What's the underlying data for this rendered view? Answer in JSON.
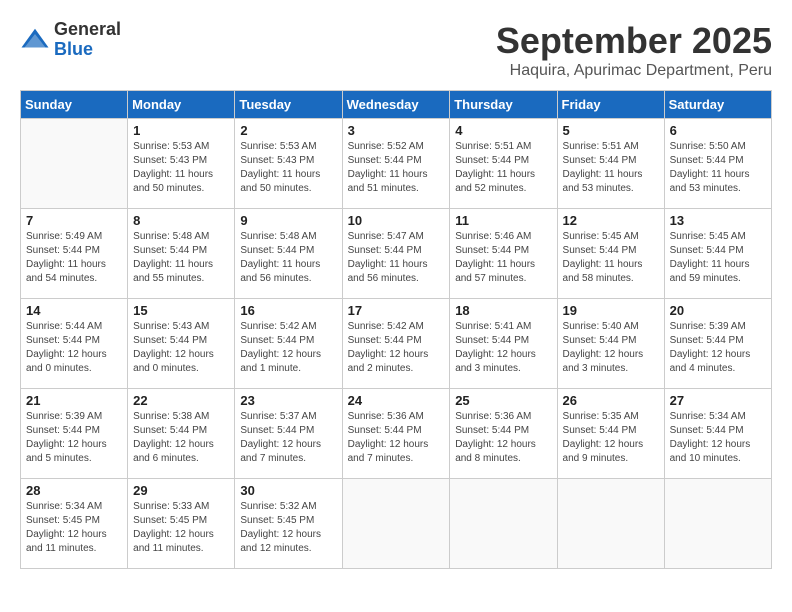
{
  "logo": {
    "general": "General",
    "blue": "Blue"
  },
  "title": "September 2025",
  "subtitle": "Haquira, Apurimac Department, Peru",
  "days_of_week": [
    "Sunday",
    "Monday",
    "Tuesday",
    "Wednesday",
    "Thursday",
    "Friday",
    "Saturday"
  ],
  "weeks": [
    [
      {
        "day": "",
        "info": ""
      },
      {
        "day": "1",
        "info": "Sunrise: 5:53 AM\nSunset: 5:43 PM\nDaylight: 11 hours\nand 50 minutes."
      },
      {
        "day": "2",
        "info": "Sunrise: 5:53 AM\nSunset: 5:43 PM\nDaylight: 11 hours\nand 50 minutes."
      },
      {
        "day": "3",
        "info": "Sunrise: 5:52 AM\nSunset: 5:44 PM\nDaylight: 11 hours\nand 51 minutes."
      },
      {
        "day": "4",
        "info": "Sunrise: 5:51 AM\nSunset: 5:44 PM\nDaylight: 11 hours\nand 52 minutes."
      },
      {
        "day": "5",
        "info": "Sunrise: 5:51 AM\nSunset: 5:44 PM\nDaylight: 11 hours\nand 53 minutes."
      },
      {
        "day": "6",
        "info": "Sunrise: 5:50 AM\nSunset: 5:44 PM\nDaylight: 11 hours\nand 53 minutes."
      }
    ],
    [
      {
        "day": "7",
        "info": "Sunrise: 5:49 AM\nSunset: 5:44 PM\nDaylight: 11 hours\nand 54 minutes."
      },
      {
        "day": "8",
        "info": "Sunrise: 5:48 AM\nSunset: 5:44 PM\nDaylight: 11 hours\nand 55 minutes."
      },
      {
        "day": "9",
        "info": "Sunrise: 5:48 AM\nSunset: 5:44 PM\nDaylight: 11 hours\nand 56 minutes."
      },
      {
        "day": "10",
        "info": "Sunrise: 5:47 AM\nSunset: 5:44 PM\nDaylight: 11 hours\nand 56 minutes."
      },
      {
        "day": "11",
        "info": "Sunrise: 5:46 AM\nSunset: 5:44 PM\nDaylight: 11 hours\nand 57 minutes."
      },
      {
        "day": "12",
        "info": "Sunrise: 5:45 AM\nSunset: 5:44 PM\nDaylight: 11 hours\nand 58 minutes."
      },
      {
        "day": "13",
        "info": "Sunrise: 5:45 AM\nSunset: 5:44 PM\nDaylight: 11 hours\nand 59 minutes."
      }
    ],
    [
      {
        "day": "14",
        "info": "Sunrise: 5:44 AM\nSunset: 5:44 PM\nDaylight: 12 hours\nand 0 minutes."
      },
      {
        "day": "15",
        "info": "Sunrise: 5:43 AM\nSunset: 5:44 PM\nDaylight: 12 hours\nand 0 minutes."
      },
      {
        "day": "16",
        "info": "Sunrise: 5:42 AM\nSunset: 5:44 PM\nDaylight: 12 hours\nand 1 minute."
      },
      {
        "day": "17",
        "info": "Sunrise: 5:42 AM\nSunset: 5:44 PM\nDaylight: 12 hours\nand 2 minutes."
      },
      {
        "day": "18",
        "info": "Sunrise: 5:41 AM\nSunset: 5:44 PM\nDaylight: 12 hours\nand 3 minutes."
      },
      {
        "day": "19",
        "info": "Sunrise: 5:40 AM\nSunset: 5:44 PM\nDaylight: 12 hours\nand 3 minutes."
      },
      {
        "day": "20",
        "info": "Sunrise: 5:39 AM\nSunset: 5:44 PM\nDaylight: 12 hours\nand 4 minutes."
      }
    ],
    [
      {
        "day": "21",
        "info": "Sunrise: 5:39 AM\nSunset: 5:44 PM\nDaylight: 12 hours\nand 5 minutes."
      },
      {
        "day": "22",
        "info": "Sunrise: 5:38 AM\nSunset: 5:44 PM\nDaylight: 12 hours\nand 6 minutes."
      },
      {
        "day": "23",
        "info": "Sunrise: 5:37 AM\nSunset: 5:44 PM\nDaylight: 12 hours\nand 7 minutes."
      },
      {
        "day": "24",
        "info": "Sunrise: 5:36 AM\nSunset: 5:44 PM\nDaylight: 12 hours\nand 7 minutes."
      },
      {
        "day": "25",
        "info": "Sunrise: 5:36 AM\nSunset: 5:44 PM\nDaylight: 12 hours\nand 8 minutes."
      },
      {
        "day": "26",
        "info": "Sunrise: 5:35 AM\nSunset: 5:44 PM\nDaylight: 12 hours\nand 9 minutes."
      },
      {
        "day": "27",
        "info": "Sunrise: 5:34 AM\nSunset: 5:44 PM\nDaylight: 12 hours\nand 10 minutes."
      }
    ],
    [
      {
        "day": "28",
        "info": "Sunrise: 5:34 AM\nSunset: 5:45 PM\nDaylight: 12 hours\nand 11 minutes."
      },
      {
        "day": "29",
        "info": "Sunrise: 5:33 AM\nSunset: 5:45 PM\nDaylight: 12 hours\nand 11 minutes."
      },
      {
        "day": "30",
        "info": "Sunrise: 5:32 AM\nSunset: 5:45 PM\nDaylight: 12 hours\nand 12 minutes."
      },
      {
        "day": "",
        "info": ""
      },
      {
        "day": "",
        "info": ""
      },
      {
        "day": "",
        "info": ""
      },
      {
        "day": "",
        "info": ""
      }
    ]
  ]
}
